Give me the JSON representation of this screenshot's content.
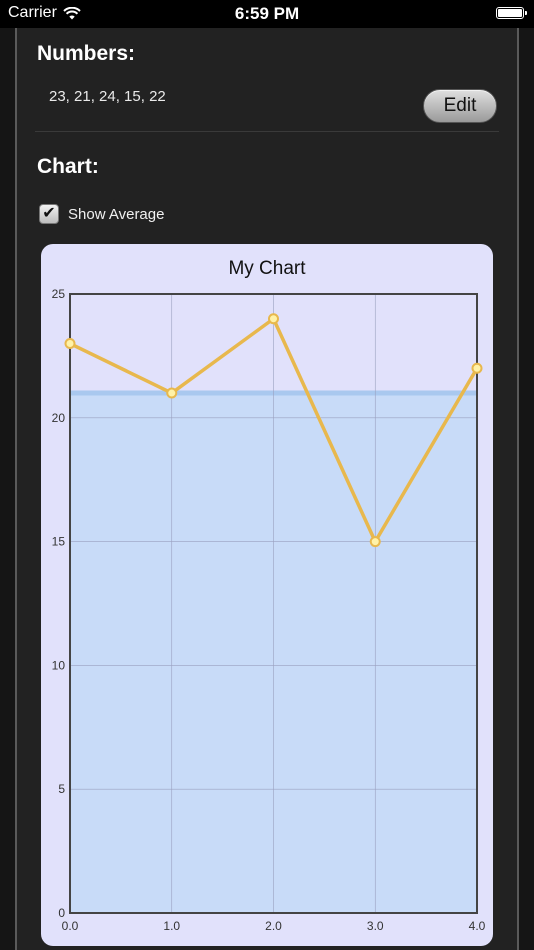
{
  "status_bar": {
    "carrier": "Carrier",
    "time": "6:59 PM"
  },
  "numbers_section": {
    "title": "Numbers:",
    "values_text": "23, 21, 24, 15, 22",
    "edit_label": "Edit"
  },
  "chart_section": {
    "title": "Chart:",
    "show_average_label": "Show Average",
    "show_average_checked": true
  },
  "chart_data": {
    "type": "line",
    "title": "My Chart",
    "x": [
      0,
      1,
      2,
      3,
      4
    ],
    "x_tick_labels": [
      "0.0",
      "1.0",
      "2.0",
      "3.0",
      "4.0"
    ],
    "y_tick_labels": [
      "0",
      "5",
      "10",
      "15",
      "20",
      "25"
    ],
    "y_ticks": [
      0,
      5,
      10,
      15,
      20,
      25
    ],
    "series": [
      {
        "values": [
          23,
          21,
          24,
          15,
          22
        ]
      }
    ],
    "average": 21,
    "xlim": [
      0,
      4
    ],
    "ylim": [
      0,
      25
    ],
    "grid": true,
    "colors": {
      "line": "#e8b84d",
      "marker_fill": "#fff2a8",
      "average_fill": "#c8dbf8",
      "average_line": "#a9c8ef",
      "grid": "#9aa0c0",
      "axis": "#444444"
    }
  }
}
